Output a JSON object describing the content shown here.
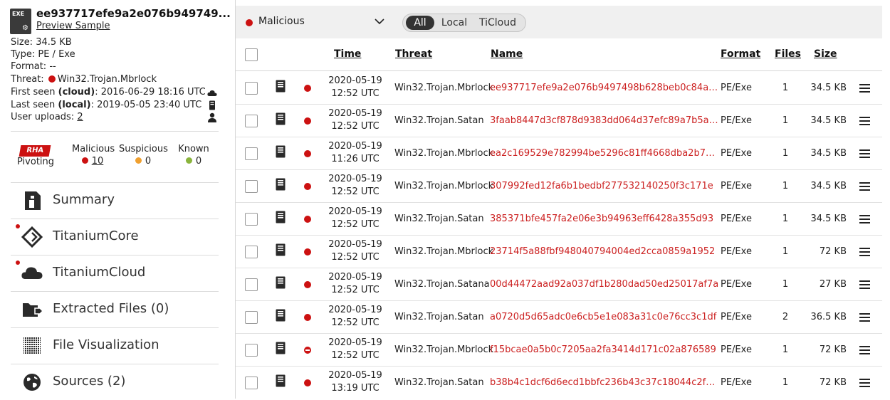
{
  "sample": {
    "file_badge": "EXE",
    "title": "ee937717efe9a2e076b949749...",
    "preview_link": "Preview Sample",
    "size": "Size: 34.5 KB",
    "type": "Type: PE / Exe",
    "format": "Format: --",
    "threat_label": "Threat:",
    "threat_value": "Win32.Trojan.Mbrlock",
    "first_seen_label": "First seen",
    "first_seen_source": "(cloud)",
    "first_seen_value": ": 2016-06-29 18:16 UTC",
    "last_seen_label": "Last seen",
    "last_seen_source": "(local)",
    "last_seen_value": ": 2019-05-05 23:40 UTC",
    "user_uploads_label": "User uploads:",
    "user_uploads_value": "2"
  },
  "pivoting": {
    "logo_text": "RHA",
    "label": "Pivoting",
    "malicious_label": "Malicious",
    "malicious_count": "10",
    "suspicious_label": "Suspicious",
    "suspicious_count": "0",
    "known_label": "Known",
    "known_count": "0",
    "colors": {
      "malicious": "#cc1111",
      "suspicious": "#f0a030",
      "known": "#8ab43c"
    }
  },
  "nav": {
    "summary": "Summary",
    "titanium_core": "TitaniumCore",
    "titanium_cloud": "TitaniumCloud",
    "extracted_files": "Extracted Files (0)",
    "file_visualization": "File Visualization",
    "sources": "Sources (2)"
  },
  "filter": {
    "selected": "Malicious",
    "scope_options": [
      "All",
      "Local",
      "TiCloud"
    ],
    "active_scope": "All"
  },
  "table": {
    "headers": {
      "time": "Time",
      "threat": "Threat",
      "name": "Name",
      "format": "Format",
      "files": "Files",
      "size": "Size"
    },
    "rows": [
      {
        "date": "2020-05-19",
        "clock": "12:52 UTC",
        "threat": "Win32.Trojan.Mbrlock",
        "name": "ee937717efe9a2e076b9497498b628beb0c84a8...",
        "format": "PE/Exe",
        "files": "1",
        "size": "34.5 KB"
      },
      {
        "date": "2020-05-19",
        "clock": "12:52 UTC",
        "threat": "Win32.Trojan.Satan",
        "name": "3faab8447d3cf878d9383dd064d37efc89a7b5a4...",
        "format": "PE/Exe",
        "files": "1",
        "size": "34.5 KB"
      },
      {
        "date": "2020-05-19",
        "clock": "11:26 UTC",
        "threat": "Win32.Trojan.Mbrlock",
        "name": "ea2c169529e782994be5296c81ff4668dba2b77a...",
        "format": "PE/Exe",
        "files": "1",
        "size": "34.5 KB"
      },
      {
        "date": "2020-05-19",
        "clock": "12:52 UTC",
        "threat": "Win32.Trojan.Mbrlock",
        "name": "307992fed12fa6b1bedbf277532140250f3c171e",
        "format": "PE/Exe",
        "files": "1",
        "size": "34.5 KB"
      },
      {
        "date": "2020-05-19",
        "clock": "12:52 UTC",
        "threat": "Win32.Trojan.Satan",
        "name": "385371bfe457fa2e06e3b94963eff6428a355d93",
        "format": "PE/Exe",
        "files": "1",
        "size": "34.5 KB"
      },
      {
        "date": "2020-05-19",
        "clock": "12:52 UTC",
        "threat": "Win32.Trojan.Mbrlock",
        "name": "23714f5a88fbf948040794004ed2cca0859a1952",
        "format": "PE/Exe",
        "files": "1",
        "size": "72 KB"
      },
      {
        "date": "2020-05-19",
        "clock": "12:52 UTC",
        "threat": "Win32.Trojan.Satana",
        "name": "00d44472aad92a037df1b280dad50ed25017af7a",
        "format": "PE/Exe",
        "files": "1",
        "size": "27 KB"
      },
      {
        "date": "2020-05-19",
        "clock": "12:52 UTC",
        "threat": "Win32.Trojan.Satan",
        "name": "a0720d5d65adc0e6cb5e1e083a31c0e76cc3c1df",
        "format": "PE/Exe",
        "files": "2",
        "size": "36.5 KB"
      },
      {
        "date": "2020-05-19",
        "clock": "12:52 UTC",
        "threat": "Win32.Trojan.Mbrlock",
        "name": "f15bcae0a5b0c7205aa2fa3414d171c02a876589",
        "format": "PE/Exe",
        "files": "1",
        "size": "72 KB"
      },
      {
        "date": "2020-05-19",
        "clock": "13:19 UTC",
        "threat": "Win32.Trojan.Satan",
        "name": "b38b4c1dcf6d6ecd1bbfc236b43c37c18044c2f42f...",
        "format": "PE/Exe",
        "files": "1",
        "size": "72 KB"
      }
    ]
  }
}
